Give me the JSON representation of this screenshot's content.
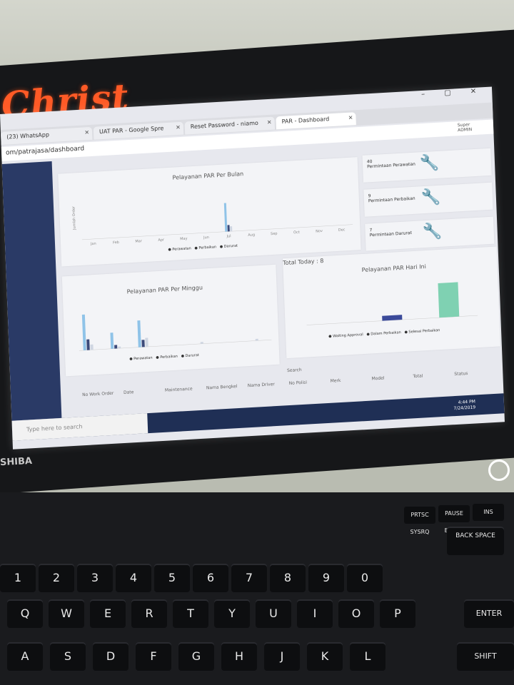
{
  "sticker_text": "Christ",
  "browser": {
    "tabs": [
      {
        "label": "(23) WhatsApp"
      },
      {
        "label": "UAT PAR - Google Spre"
      },
      {
        "label": "Reset Password - niamo"
      },
      {
        "label": "PAR - Dashboard"
      }
    ],
    "address": "om/patrajasa/dashboard",
    "user_name": "Super",
    "user_role": "ADMIN"
  },
  "dashboard": {
    "monthly": {
      "title": "Pelayanan PAR Per Bulan",
      "ylabel": "Jumlah Order",
      "legend": [
        "Perawatan",
        "Perbaikan",
        "Darurat"
      ]
    },
    "weekly": {
      "title": "Pelayanan PAR Per Minggu",
      "legend": [
        "Perawatan",
        "Perbaikan",
        "Darurat"
      ]
    },
    "today": {
      "total_label": "Total Today : 8",
      "title": "Pelayanan PAR Hari Ini",
      "legend": [
        "Waiting Approval",
        "Dalam Perbaikan",
        "Selesai Perbaikan"
      ]
    },
    "stats": [
      {
        "num": "40",
        "label": "Permintaan Perawatan"
      },
      {
        "num": "9",
        "label": "Permintaan Perbaikan"
      },
      {
        "num": "7",
        "label": "Permintaan Darurat"
      }
    ],
    "table": {
      "search_label": "Search",
      "columns": [
        "No Work Order",
        "Date",
        "Maintenance",
        "Nama Bengkel",
        "Nama Driver",
        "No Polisi",
        "Merk",
        "Model",
        "Total",
        "Status"
      ]
    }
  },
  "chart_data": [
    {
      "type": "bar",
      "title": "Pelayanan PAR Per Bulan",
      "ylabel": "Jumlah Order",
      "categories": [
        "Jan",
        "Feb",
        "Mar",
        "Apr",
        "May",
        "Jun",
        "Jul",
        "Aug",
        "Sep",
        "Oct",
        "Nov",
        "Dec"
      ],
      "series": [
        {
          "name": "Perawatan",
          "values": [
            0,
            0,
            0,
            0,
            0,
            0,
            40,
            0,
            0,
            0,
            0,
            0
          ]
        },
        {
          "name": "Perbaikan",
          "values": [
            0,
            0,
            0,
            0,
            0,
            0,
            9,
            0,
            0,
            0,
            0,
            0
          ]
        },
        {
          "name": "Darurat",
          "values": [
            0,
            0,
            0,
            0,
            0,
            0,
            7,
            0,
            0,
            0,
            0,
            0
          ]
        }
      ],
      "ylim": [
        0,
        60
      ]
    },
    {
      "type": "bar",
      "title": "Pelayanan PAR Per Minggu",
      "series": [
        {
          "name": "Perawatan",
          "values": [
            20,
            9,
            15,
            0,
            0,
            0,
            0
          ]
        },
        {
          "name": "Perbaikan",
          "values": [
            6,
            2,
            4,
            0,
            0,
            0,
            0
          ]
        },
        {
          "name": "Darurat",
          "values": [
            3,
            1,
            5,
            0,
            1,
            0,
            1
          ]
        }
      ]
    },
    {
      "type": "bar",
      "title": "Pelayanan PAR Hari Ini",
      "categories": [
        "Waiting Approval",
        "Dalam Perbaikan",
        "Selesai Perbaikan"
      ],
      "values": [
        0,
        1,
        7
      ]
    }
  ],
  "taskbar": {
    "search_placeholder": "Type here to search",
    "time": "4:44 PM",
    "date": "7/24/2019"
  },
  "laptop_brand": "SHIBA",
  "keys": {
    "row_num": [
      "1",
      "2",
      "3",
      "4",
      "5",
      "6",
      "7",
      "8",
      "9",
      "0"
    ],
    "row_q": [
      "Q",
      "W",
      "E",
      "R",
      "T",
      "Y",
      "U",
      "I",
      "O",
      "P"
    ],
    "row_a": [
      "A",
      "S",
      "D",
      "F",
      "G",
      "H",
      "J",
      "K",
      "L"
    ],
    "enter": "ENTER",
    "shift": "SHIFT",
    "backspace": "BACK SPACE",
    "fkeys": [
      "PRTSC SYSRQ",
      "PAUSE BREAK",
      "INS"
    ]
  }
}
